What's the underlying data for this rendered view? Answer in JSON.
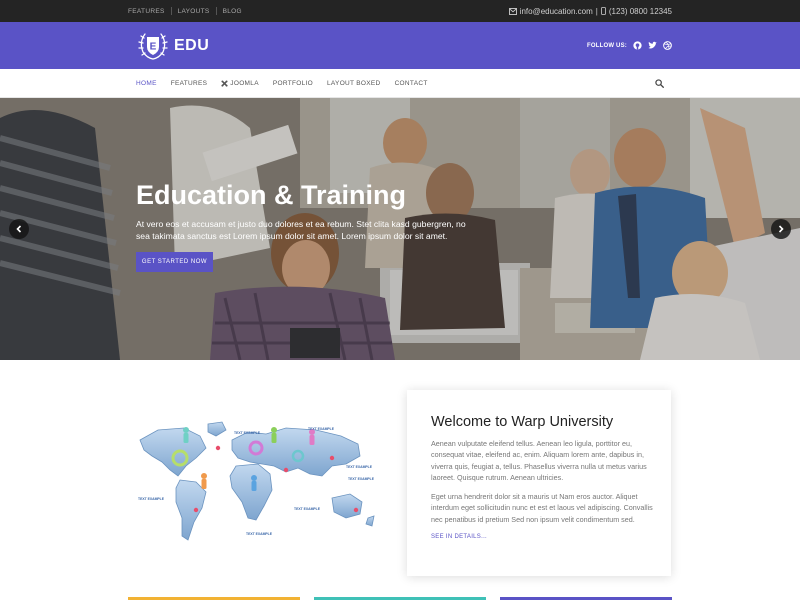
{
  "topbar": {
    "links": [
      "FEATURES",
      "LAYOUTS",
      "BLOG"
    ],
    "email": "info@education.com",
    "separator": "|",
    "phone": "(123) 0800 12345"
  },
  "brand": {
    "logo_text": "EDU",
    "logo_letter": "E",
    "follow_label": "FOLLOW US:"
  },
  "nav": {
    "items": [
      "HOME",
      "FEATURES",
      "JOOMLA",
      "PORTFOLIO",
      "LAYOUT BOXED",
      "CONTACT"
    ],
    "active_index": 0
  },
  "hero": {
    "title": "Education & Training",
    "text": "At vero eos et accusam et justo duo dolores et ea rebum. Stet clita kasd gubergren, no sea takimata sanctus est Lorem ipsum dolor sit amet. Lorem ipsum dolor sit amet.",
    "button": "GET STARTED NOW"
  },
  "map": {
    "labels": [
      "TEXT EXAMPLE",
      "TEXT EXAMPLE",
      "TEXT EXAMPLE",
      "TEXT EXAMPLE",
      "TEXT EXAMPLE",
      "TEXT EXAMPLE",
      "TEXT EXAMPLE"
    ]
  },
  "welcome": {
    "title": "Welcome to Warp University",
    "p1": "Aenean vulputate eleifend tellus. Aenean leo ligula, porttitor eu, consequat vitae, eleifend ac, enim. Aliquam lorem ante, dapibus in, viverra quis, feugiat a, tellus. Phasellus viverra nulla ut metus varius laoreet. Quisque rutrum. Aenean ultricies.",
    "p2": "Eget urna hendrerit dolor sit a mauris ut Nam eros auctor. Aliquet interdum eget sollicitudin nunc et est et laous vel adipiscing. Convallis nec penatibus id pretium Sed non ipsum velit condimentum sed.",
    "link": "SEE IN DETAILS..."
  },
  "colors": {
    "brand": "#5a53c6",
    "topbar": "#242424",
    "strip1": "#f2b233",
    "strip2": "#3fc1b7",
    "strip3": "#5a53c6"
  }
}
